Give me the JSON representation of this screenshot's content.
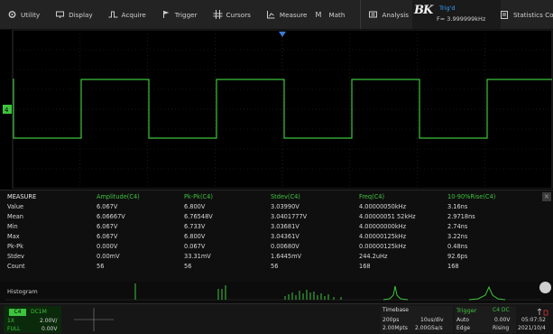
{
  "menu": {
    "items": [
      {
        "label": "Utility",
        "icon": "gear-icon"
      },
      {
        "label": "Display",
        "icon": "monitor-icon"
      },
      {
        "label": "Acquire",
        "icon": "acquire-icon"
      },
      {
        "label": "Trigger",
        "icon": "trigger-flag-icon"
      },
      {
        "label": "Cursors",
        "icon": "cursors-icon"
      },
      {
        "label": "Measure",
        "icon": "measure-icon"
      },
      {
        "label": "Math",
        "icon": "math-icon"
      },
      {
        "label": "Analysis",
        "icon": "analysis-icon"
      }
    ],
    "brand_text": "BK",
    "trigger_status": "Trig'd",
    "trigger_freq": "F= 3.999999kHz",
    "stats_config": "Statistics Config"
  },
  "measure": {
    "title": "MEASURE",
    "columns": [
      "Amplitude(C4)",
      "Pk-Pk(C4)",
      "Stdev(C4)",
      "Freq(C4)",
      "10-90%Rise(C4)"
    ],
    "rows": [
      {
        "label": "Value",
        "cells": [
          "6.067V",
          "6.800V",
          "3.03990V",
          "4.00000050kHz",
          "3.16ns"
        ]
      },
      {
        "label": "Mean",
        "cells": [
          "6.06667V",
          "6.76548V",
          "3.0401777V",
          "4.00000051 52kHz",
          "2.9718ns"
        ]
      },
      {
        "label": "Min",
        "cells": [
          "6.067V",
          "6.733V",
          "3.03681V",
          "4.00000000kHz",
          "2.74ns"
        ]
      },
      {
        "label": "Max",
        "cells": [
          "6.067V",
          "6.800V",
          "3.04361V",
          "4.00000125kHz",
          "3.22ns"
        ]
      },
      {
        "label": "Pk-Pk",
        "cells": [
          "0.000V",
          "0.067V",
          "0.00680V",
          "0.00000125kHz",
          "0.48ns"
        ]
      },
      {
        "label": "Stdev",
        "cells": [
          "0.00mV",
          "33.31mV",
          "1.6445mV",
          "244.2uHz",
          "92.6ps"
        ]
      },
      {
        "label": "Count",
        "cells": [
          "56",
          "56",
          "56",
          "168",
          "168"
        ]
      }
    ]
  },
  "histogram": {
    "label": "Histogram"
  },
  "channel": {
    "name": "C4",
    "coupling": "DC1M",
    "probe": "1X",
    "scale": "2.00V/",
    "bw": "FULL",
    "offset": "0.00V"
  },
  "timebase": {
    "title": "Timebase",
    "delay": "200ps",
    "div": "10us/div",
    "points": "2.00Mpts",
    "rate": "2.00GSa/s"
  },
  "trigger": {
    "title": "Trigger",
    "source": "C4 DC",
    "mode": "Auto",
    "level": "0.00V",
    "type": "Edge",
    "slope": "Rising"
  },
  "clock": {
    "time": "05:07:52",
    "date": "2021/10/4"
  },
  "colors": {
    "channel": "#3ec33e",
    "trigger_marker": "#3a7bd5",
    "grid": "#3b3b3b"
  }
}
